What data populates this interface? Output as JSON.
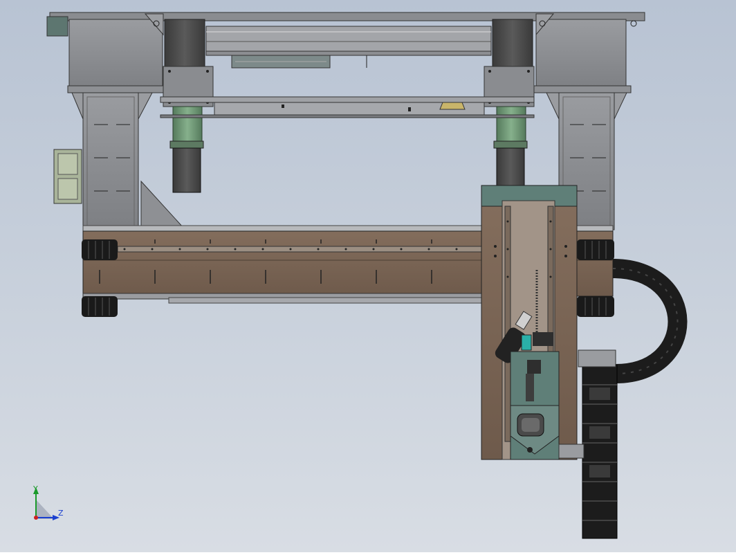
{
  "triad": {
    "y_label": "Y",
    "z_label": "Z",
    "color_y": "#1a9a2a",
    "color_z": "#1a3fd0",
    "color_x": "#cc2020"
  },
  "colors": {
    "background_top": "#b8c3d3",
    "background_bottom": "#d8dde4",
    "frame_grey": "#8e9094",
    "beam_brown": "#7a6656",
    "motor_green": "#6f9a76",
    "motor_dark": "#4a4a4a",
    "cable_chain": "#1c1c1c",
    "plate_teal": "#5f7f78"
  }
}
